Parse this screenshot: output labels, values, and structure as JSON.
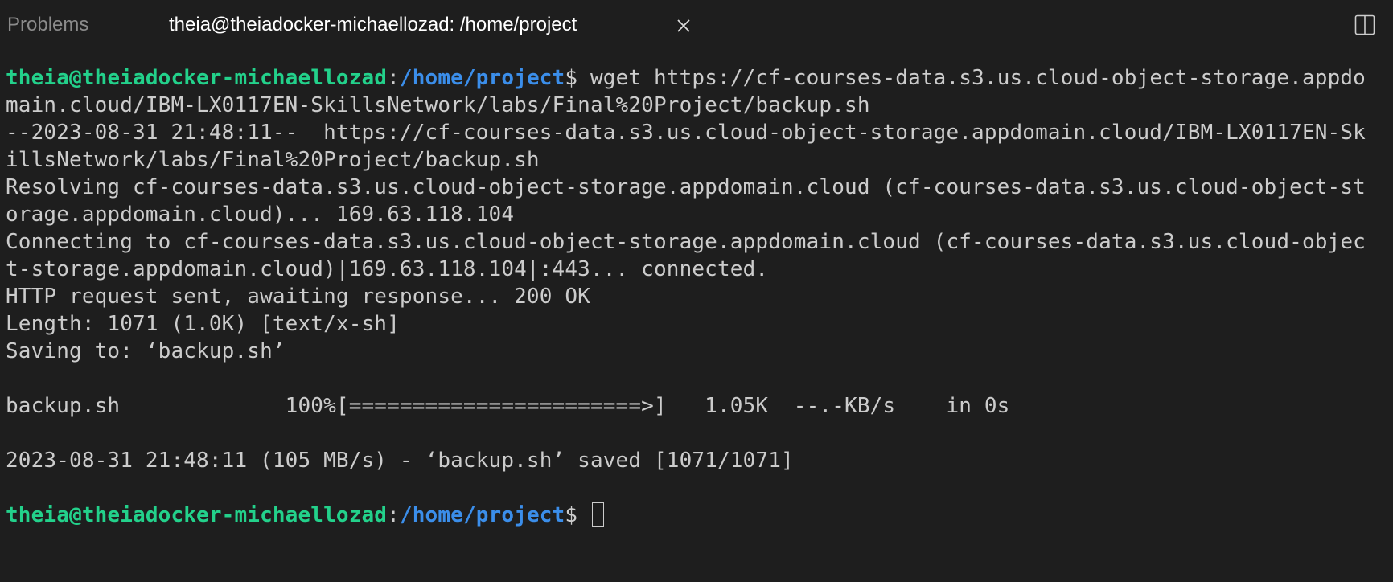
{
  "tabs": {
    "problems": "Problems",
    "terminal": "theia@theiadocker-michaellozad: /home/project"
  },
  "terminal": {
    "prompt_user": "theia@theiadocker-michaellozad",
    "prompt_sep": ":",
    "prompt_path": "/home/project",
    "prompt_dollar": "$ ",
    "command": "wget https://cf-courses-data.s3.us.cloud-object-storage.appdo",
    "output": [
      "main.cloud/IBM-LX0117EN-SkillsNetwork/labs/Final%20Project/backup.sh",
      "--2023-08-31 21:48:11--  https://cf-courses-data.s3.us.cloud-object-storage.appdomain.cloud/IBM-LX0117EN-Sk",
      "illsNetwork/labs/Final%20Project/backup.sh",
      "Resolving cf-courses-data.s3.us.cloud-object-storage.appdomain.cloud (cf-courses-data.s3.us.cloud-object-st",
      "orage.appdomain.cloud)... 169.63.118.104",
      "Connecting to cf-courses-data.s3.us.cloud-object-storage.appdomain.cloud (cf-courses-data.s3.us.cloud-objec",
      "t-storage.appdomain.cloud)|169.63.118.104|:443... connected.",
      "HTTP request sent, awaiting response... 200 OK",
      "Length: 1071 (1.0K) [text/x-sh]",
      "Saving to: ‘backup.sh’",
      "",
      "backup.sh             100%[=======================>]   1.05K  --.-KB/s    in 0s",
      "",
      "2023-08-31 21:48:11 (105 MB/s) - ‘backup.sh’ saved [1071/1071]",
      ""
    ]
  }
}
